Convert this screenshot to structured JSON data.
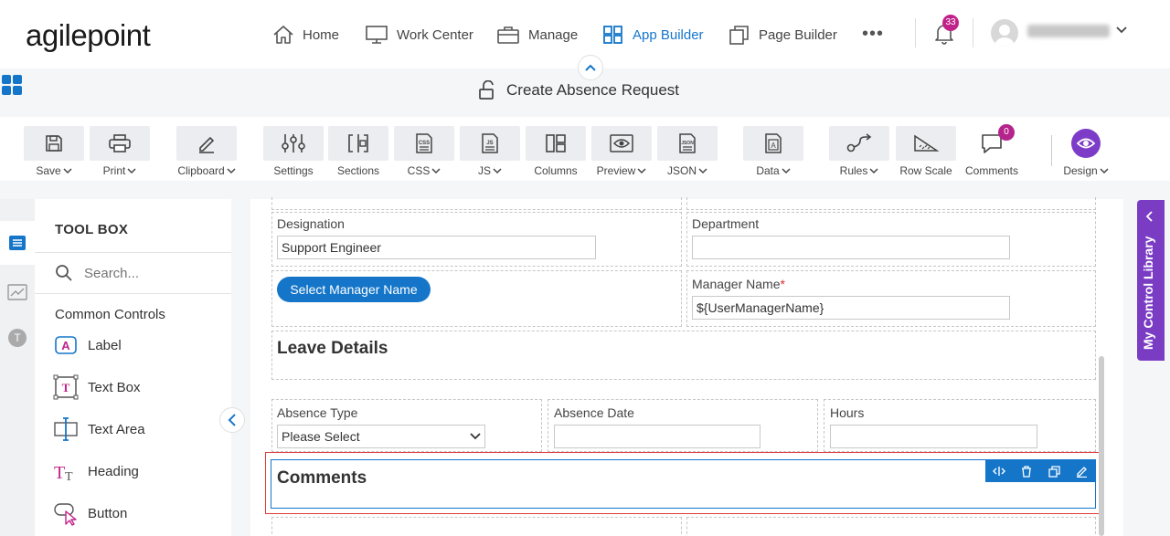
{
  "header": {
    "logo_text": "agilepoint",
    "nav": [
      {
        "label": "Home",
        "icon": "home-icon"
      },
      {
        "label": "Work Center",
        "icon": "monitor-icon"
      },
      {
        "label": "Manage",
        "icon": "briefcase-icon"
      },
      {
        "label": "App Builder",
        "icon": "grid-icon",
        "active": true
      },
      {
        "label": "Page Builder",
        "icon": "pages-icon"
      }
    ],
    "more_label": "•••",
    "notification_count": "33",
    "accent_color": "#1576c9"
  },
  "form": {
    "title": "Create Absence Request"
  },
  "toolbar": {
    "items": [
      {
        "label": "Save",
        "icon": "save-icon",
        "dropdown": true
      },
      {
        "label": "Print",
        "icon": "print-icon",
        "dropdown": true
      },
      {
        "label": "Clipboard",
        "icon": "pencil-icon",
        "dropdown": true
      },
      {
        "label": "Settings",
        "icon": "sliders-icon",
        "dropdown": false
      },
      {
        "label": "Sections",
        "icon": "sections-icon",
        "dropdown": false
      },
      {
        "label": "CSS",
        "icon": "css-file-icon",
        "dropdown": true
      },
      {
        "label": "JS",
        "icon": "js-file-icon",
        "dropdown": true
      },
      {
        "label": "Columns",
        "icon": "columns-icon",
        "dropdown": false
      },
      {
        "label": "Preview",
        "icon": "eye-icon",
        "dropdown": true
      },
      {
        "label": "JSON",
        "icon": "json-file-icon",
        "dropdown": true
      },
      {
        "label": "Data",
        "icon": "data-icon",
        "dropdown": true
      },
      {
        "label": "Rules",
        "icon": "rules-icon",
        "dropdown": true
      },
      {
        "label": "Row Scale",
        "icon": "row-scale-icon",
        "dropdown": false
      },
      {
        "label": "Comments",
        "icon": "comment-icon",
        "dropdown": false
      },
      {
        "label": "Design",
        "icon": "design-eye-icon",
        "dropdown": true
      }
    ],
    "comments_count": "0"
  },
  "toolbox": {
    "title": "TOOL BOX",
    "search_placeholder": "Search...",
    "section": "Common Controls",
    "controls": [
      {
        "label": "Label",
        "icon": "label-icon"
      },
      {
        "label": "Text Box",
        "icon": "textbox-icon"
      },
      {
        "label": "Text Area",
        "icon": "textarea-icon"
      },
      {
        "label": "Heading",
        "icon": "heading-icon"
      },
      {
        "label": "Button",
        "icon": "button-cursor-icon"
      }
    ]
  },
  "canvas": {
    "designation_label": "Designation",
    "designation_value": "Support Engineer",
    "department_label": "Department",
    "department_value": "",
    "select_manager_button": "Select Manager Name",
    "manager_name_label": "Manager Name",
    "manager_required": "*",
    "manager_name_value": "${UserManagerName}",
    "leave_details_heading": "Leave Details",
    "absence_type_label": "Absence Type",
    "absence_type_value": "Please Select",
    "absence_date_label": "Absence Date",
    "absence_date_value": "",
    "hours_label": "Hours",
    "hours_value": "",
    "comments_heading": "Comments"
  },
  "right_panel": {
    "label": "My Control Library",
    "color": "#7b3cc4"
  }
}
